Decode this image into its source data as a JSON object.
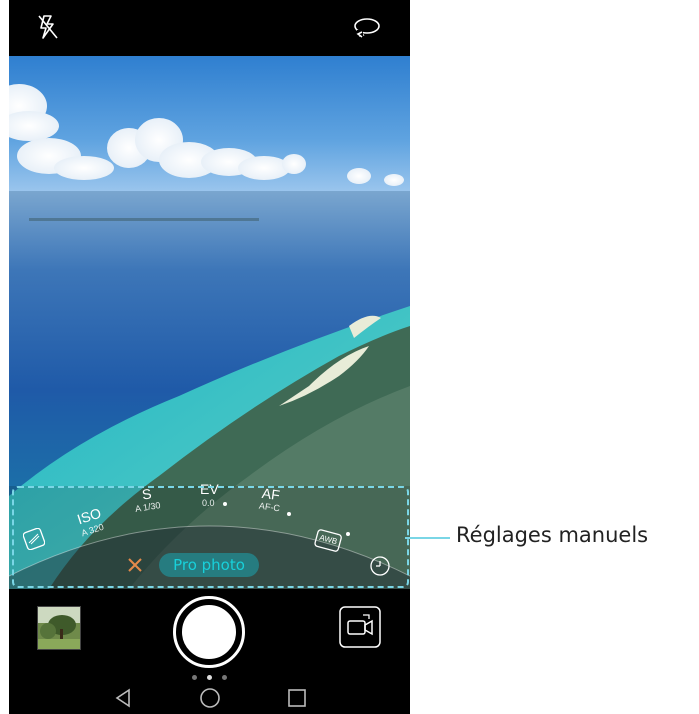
{
  "camera": {
    "mode_label": "Pro photo",
    "params": [
      {
        "name": "ISO",
        "value": "A 320"
      },
      {
        "name": "S",
        "value": "A 1/30"
      },
      {
        "name": "EV",
        "value": "0.0"
      },
      {
        "name": "AF",
        "value": "AF-C"
      }
    ],
    "awb_label": "AWB"
  },
  "annotation": {
    "callout": "Réglages manuels"
  },
  "icons": {
    "flash": "flash-off-icon",
    "switch": "switch-camera-icon",
    "metering": "metering-icon",
    "close": "close-icon",
    "timer": "timer-icon",
    "video": "video-icon",
    "back": "nav-back-icon",
    "home": "nav-home-icon",
    "recent": "nav-recent-icon"
  },
  "colors": {
    "accent": "#18d0da",
    "highlight": "#7ad6e6",
    "close": "#e58a4a"
  }
}
